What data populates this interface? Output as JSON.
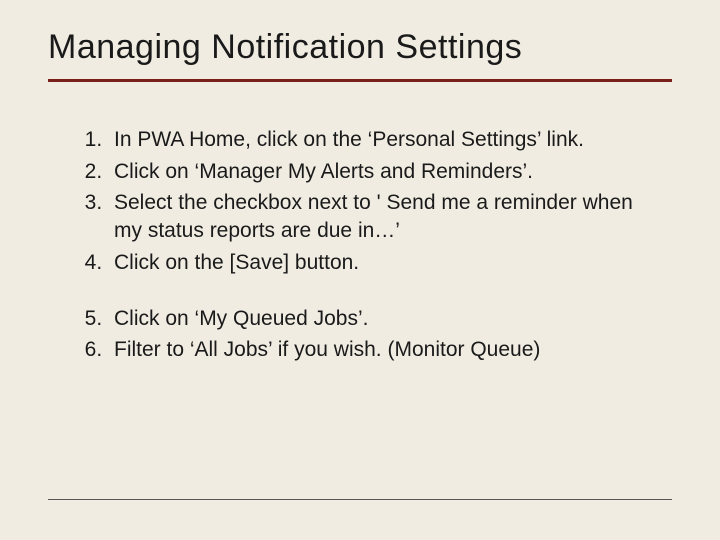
{
  "title": "Managing Notification Settings",
  "steps_a": [
    "In PWA Home, click on the ‘Personal Settings’ link.",
    "Click on ‘Manager My Alerts and Reminders’.",
    "Select the checkbox next to ' Send me a reminder when my status reports are due in…’",
    "Click on the [Save] button."
  ],
  "steps_b": [
    "Click on ‘My Queued Jobs’.",
    "Filter to ‘All Jobs’ if you wish.  (Monitor Queue)"
  ]
}
